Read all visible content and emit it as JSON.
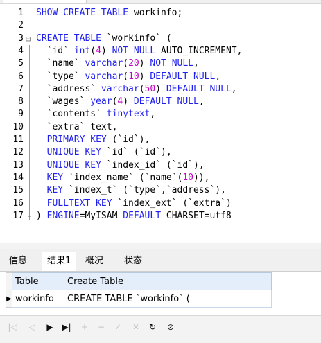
{
  "editor": {
    "lines": [
      {
        "n": "1",
        "fold": "",
        "tokens": [
          {
            "t": "SHOW CREATE TABLE ",
            "c": "kw"
          },
          {
            "t": "workinfo;",
            "c": ""
          }
        ]
      },
      {
        "n": "2",
        "fold": "",
        "tokens": []
      },
      {
        "n": "3",
        "fold": "⊟",
        "tokens": [
          {
            "t": "CREATE TABLE ",
            "c": "kw"
          },
          {
            "t": "`workinfo` (",
            "c": ""
          }
        ]
      },
      {
        "n": "4",
        "fold": "",
        "tokens": [
          {
            "t": "  `id` ",
            "c": ""
          },
          {
            "t": "int",
            "c": "kw"
          },
          {
            "t": "(",
            "c": ""
          },
          {
            "t": "4",
            "c": "num"
          },
          {
            "t": ") ",
            "c": ""
          },
          {
            "t": "NOT NULL",
            "c": "kw"
          },
          {
            "t": " AUTO_INCREMENT,",
            "c": ""
          }
        ]
      },
      {
        "n": "5",
        "fold": "",
        "tokens": [
          {
            "t": "  `name` ",
            "c": ""
          },
          {
            "t": "varchar",
            "c": "kw"
          },
          {
            "t": "(",
            "c": ""
          },
          {
            "t": "20",
            "c": "num"
          },
          {
            "t": ") ",
            "c": ""
          },
          {
            "t": "NOT NULL",
            "c": "kw"
          },
          {
            "t": ",",
            "c": ""
          }
        ]
      },
      {
        "n": "6",
        "fold": "",
        "tokens": [
          {
            "t": "  `type` ",
            "c": ""
          },
          {
            "t": "varchar",
            "c": "kw"
          },
          {
            "t": "(",
            "c": ""
          },
          {
            "t": "10",
            "c": "num"
          },
          {
            "t": ") ",
            "c": ""
          },
          {
            "t": "DEFAULT NULL",
            "c": "kw"
          },
          {
            "t": ",",
            "c": ""
          }
        ]
      },
      {
        "n": "7",
        "fold": "",
        "tokens": [
          {
            "t": "  `address` ",
            "c": ""
          },
          {
            "t": "varchar",
            "c": "kw"
          },
          {
            "t": "(",
            "c": ""
          },
          {
            "t": "50",
            "c": "num"
          },
          {
            "t": ") ",
            "c": ""
          },
          {
            "t": "DEFAULT NULL",
            "c": "kw"
          },
          {
            "t": ",",
            "c": ""
          }
        ]
      },
      {
        "n": "8",
        "fold": "",
        "tokens": [
          {
            "t": "  `wages` ",
            "c": ""
          },
          {
            "t": "year",
            "c": "kw"
          },
          {
            "t": "(",
            "c": ""
          },
          {
            "t": "4",
            "c": "num"
          },
          {
            "t": ") ",
            "c": ""
          },
          {
            "t": "DEFAULT NULL",
            "c": "kw"
          },
          {
            "t": ",",
            "c": ""
          }
        ]
      },
      {
        "n": "9",
        "fold": "",
        "tokens": [
          {
            "t": "  `contents` ",
            "c": ""
          },
          {
            "t": "tinytext",
            "c": "kw"
          },
          {
            "t": ",",
            "c": ""
          }
        ]
      },
      {
        "n": "10",
        "fold": "",
        "tokens": [
          {
            "t": "  `extra` text,",
            "c": ""
          }
        ]
      },
      {
        "n": "11",
        "fold": "",
        "tokens": [
          {
            "t": "  ",
            "c": ""
          },
          {
            "t": "PRIMARY KEY",
            "c": "kw"
          },
          {
            "t": " (`id`),",
            "c": ""
          }
        ]
      },
      {
        "n": "12",
        "fold": "",
        "tokens": [
          {
            "t": "  ",
            "c": ""
          },
          {
            "t": "UNIQUE KEY",
            "c": "kw"
          },
          {
            "t": " `id` (`id`),",
            "c": ""
          }
        ]
      },
      {
        "n": "13",
        "fold": "",
        "tokens": [
          {
            "t": "  ",
            "c": ""
          },
          {
            "t": "UNIQUE KEY",
            "c": "kw"
          },
          {
            "t": " `index_id` (`id`),",
            "c": ""
          }
        ]
      },
      {
        "n": "14",
        "fold": "",
        "tokens": [
          {
            "t": "  ",
            "c": ""
          },
          {
            "t": "KEY",
            "c": "kw"
          },
          {
            "t": " `index_name` (`name`(",
            "c": ""
          },
          {
            "t": "10",
            "c": "num"
          },
          {
            "t": ")),",
            "c": ""
          }
        ]
      },
      {
        "n": "15",
        "fold": "",
        "tokens": [
          {
            "t": "  ",
            "c": ""
          },
          {
            "t": "KEY",
            "c": "kw"
          },
          {
            "t": " `index_t` (`type`,`address`),",
            "c": ""
          }
        ]
      },
      {
        "n": "16",
        "fold": "",
        "tokens": [
          {
            "t": "  ",
            "c": ""
          },
          {
            "t": "FULLTEXT KEY",
            "c": "kw"
          },
          {
            "t": " `index_ext` (`extra`)",
            "c": ""
          }
        ]
      },
      {
        "n": "17",
        "fold": "└",
        "tokens": [
          {
            "t": ") ",
            "c": ""
          },
          {
            "t": "ENGINE",
            "c": "kw"
          },
          {
            "t": "=MyISAM ",
            "c": ""
          },
          {
            "t": "DEFAULT",
            "c": "kw"
          },
          {
            "t": " CHARSET=utf8",
            "c": ""
          }
        ]
      }
    ]
  },
  "result_tabs": [
    {
      "label": "信息",
      "active": false
    },
    {
      "label": "结果1",
      "active": true
    },
    {
      "label": "概况",
      "active": false
    },
    {
      "label": "状态",
      "active": false
    }
  ],
  "result_grid": {
    "columns": [
      "Table",
      "Create Table"
    ],
    "row_marker": "▶",
    "rows": [
      [
        "workinfo",
        "CREATE TABLE `workinfo` ("
      ]
    ]
  },
  "toolbar": {
    "buttons": [
      {
        "name": "first-record-icon",
        "glyph": "|◁",
        "enabled": false
      },
      {
        "name": "prev-record-icon",
        "glyph": "◁",
        "enabled": false
      },
      {
        "name": "next-record-icon",
        "glyph": "▶",
        "enabled": true
      },
      {
        "name": "last-record-icon",
        "glyph": "▶|",
        "enabled": true
      },
      {
        "name": "add-record-icon",
        "glyph": "+",
        "enabled": false
      },
      {
        "name": "delete-record-icon",
        "glyph": "−",
        "enabled": false
      },
      {
        "name": "apply-changes-icon",
        "glyph": "✓",
        "enabled": false
      },
      {
        "name": "discard-changes-icon",
        "glyph": "✕",
        "enabled": false
      },
      {
        "name": "refresh-icon",
        "glyph": "↻",
        "enabled": true
      },
      {
        "name": "stop-icon",
        "glyph": "⊘",
        "enabled": true
      }
    ]
  },
  "colors": {
    "keyword": "#1f1ff0",
    "number": "#c000c0",
    "header_bg": "#e4eefa"
  }
}
